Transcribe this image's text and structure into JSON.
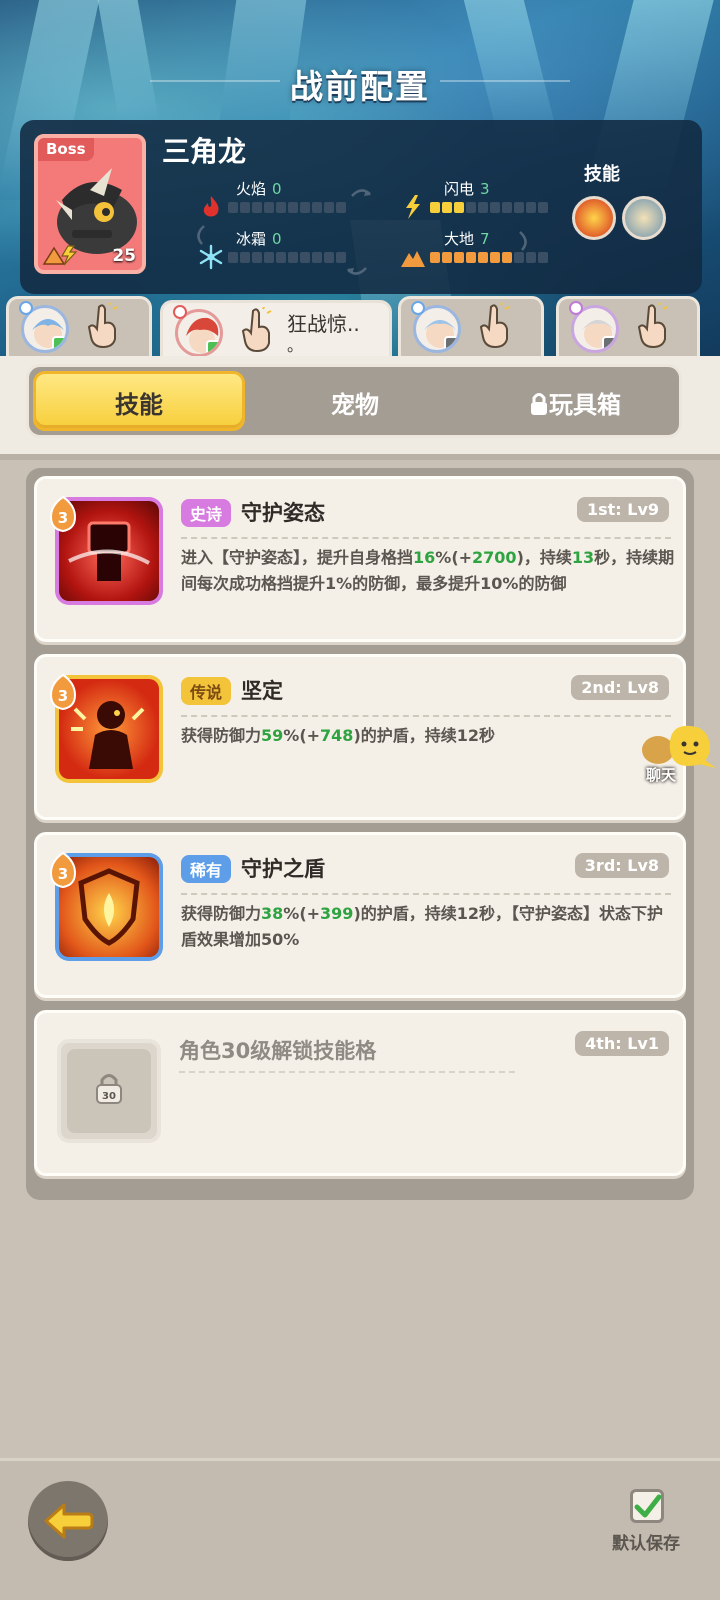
{
  "header": {
    "title": "战前配置"
  },
  "boss": {
    "tag": "Boss",
    "name": "三角龙",
    "level": "25",
    "stats": {
      "fire": {
        "label": "火焰",
        "value": "0",
        "fraction": 0
      },
      "ice": {
        "label": "冰霜",
        "value": "0",
        "fraction": 0
      },
      "thunder": {
        "label": "闪电",
        "value": "3",
        "fraction": 0.3
      },
      "earth": {
        "label": "大地",
        "value": "7",
        "fraction": 0.7
      }
    },
    "skills_label": "技能",
    "skill_icons": [
      "fire-skill-icon",
      "wing-skill-icon"
    ]
  },
  "characters": [
    {
      "name": "",
      "active": false,
      "elem_color": "#6aa6e8"
    },
    {
      "name": "狂战惊..",
      "name_extra": "。",
      "active": true,
      "elem_color": "#e25b5b"
    },
    {
      "name": "",
      "active": false,
      "elem_color": "#6aa6e8"
    },
    {
      "name": "",
      "active": false,
      "elem_color": "#c07ad8"
    }
  ],
  "subtabs": {
    "skills": "技能",
    "pets": "宠物",
    "toybox": "玩具箱"
  },
  "skills": [
    {
      "rarity": "史诗",
      "title": "守护姿态",
      "slot": "1st: Lv9",
      "pin_level": "3",
      "desc_parts": [
        "进入【守护姿态】，提升自身格挡",
        "16",
        "%(+",
        "2700",
        ")，持续",
        "13",
        "秒，持续期间每次成功格挡提升1%的防御，最多提升10%的防御"
      ]
    },
    {
      "rarity": "传说",
      "title": "坚定",
      "slot": "2nd: Lv8",
      "pin_level": "3",
      "desc_parts": [
        "获得防御力",
        "59",
        "%(+",
        "748",
        ")的护盾，持续12秒"
      ]
    },
    {
      "rarity": "稀有",
      "title": "守护之盾",
      "slot": "3rd: Lv8",
      "pin_level": "3",
      "desc_parts": [
        "获得防御力",
        "38",
        "%(+",
        "399",
        ")的护盾，持续12秒，【守护姿态】状态下护盾效果增加50%"
      ]
    }
  ],
  "locked_slot": {
    "title": "角色30级解锁技能格",
    "slot": "4th: Lv1",
    "lock_level": "30"
  },
  "chat": {
    "label": "聊天"
  },
  "footer": {
    "save_label": "默认保存"
  }
}
